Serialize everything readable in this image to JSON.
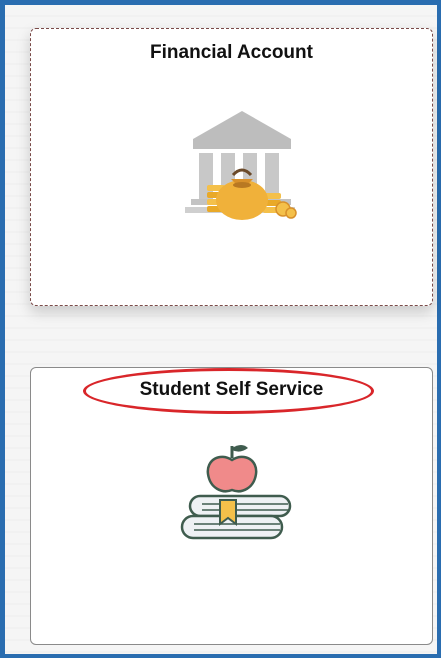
{
  "tiles": [
    {
      "title": "Financial Account",
      "icon": "bank-money-bag-icon"
    },
    {
      "title": "Student Self Service",
      "icon": "apple-books-icon",
      "highlighted": true,
      "highlight_color": "#d9262a"
    }
  ],
  "colors": {
    "frame_border": "#2a6db0",
    "gold": "#f0b13a",
    "apple_red": "#f08a8a",
    "apple_stem": "#3f5c4e"
  }
}
